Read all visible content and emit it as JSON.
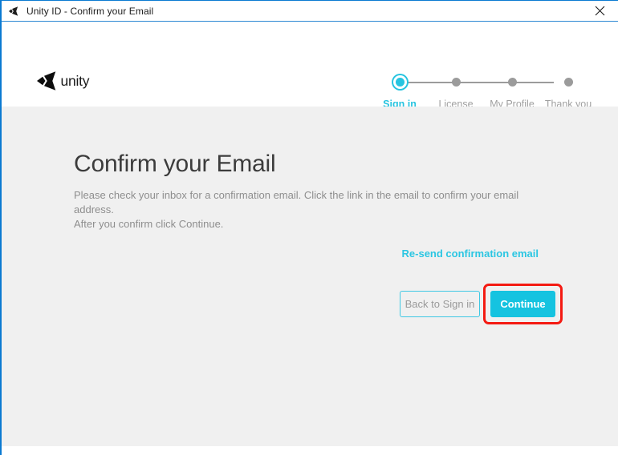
{
  "window": {
    "titlebar": {
      "icon": "unity-cube-icon",
      "title": "Unity ID - Confirm your Email",
      "close_label": "✕"
    },
    "accent_border_color": "#0b7ad1"
  },
  "header": {
    "logo": {
      "icon": "unity-logo-icon",
      "wordmark": "unity"
    },
    "stepper": {
      "active_index": 0,
      "steps": [
        {
          "label": "Sign in",
          "state": "active"
        },
        {
          "label": "License",
          "state": "inactive"
        },
        {
          "label": "My Profile",
          "state": "inactive"
        },
        {
          "label": "Thank you",
          "state": "inactive"
        }
      ],
      "active_color": "#27c4e0",
      "inactive_color": "#9b9b9b"
    }
  },
  "main": {
    "title": "Confirm your Email",
    "body_line_1": "Please check your inbox for a confirmation email. Click the link in the email to confirm your email address.",
    "body_line_2": "After you confirm click Continue.",
    "resend_link": "Re-send confirmation email",
    "buttons": {
      "back": "Back to Sign in",
      "continue": "Continue"
    },
    "accent_color": "#15c3e0",
    "link_color": "#2bc6e2",
    "focus_ring_color": "#f41a12",
    "background_color": "#f0f0f0"
  }
}
